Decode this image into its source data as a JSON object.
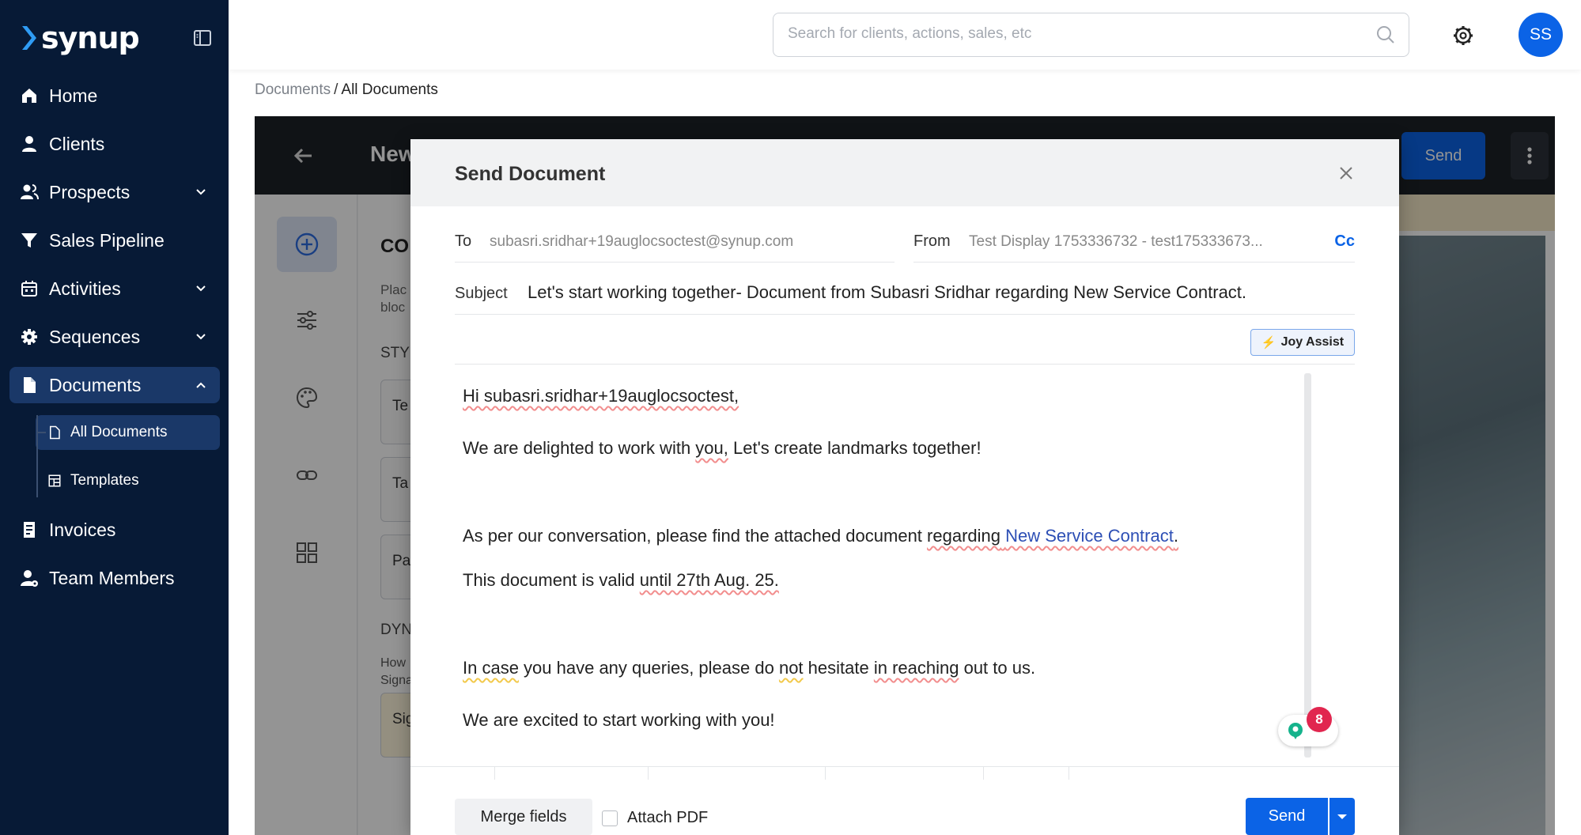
{
  "brand": {
    "name": "synup",
    "accent": "#0b63e6",
    "sidebar_bg": "#071a36"
  },
  "sidebar": {
    "items": [
      {
        "label": "Home",
        "icon": "home-icon"
      },
      {
        "label": "Clients",
        "icon": "user-icon"
      },
      {
        "label": "Prospects",
        "icon": "prospects-icon",
        "expandable": true
      },
      {
        "label": "Sales Pipeline",
        "icon": "funnel-icon"
      },
      {
        "label": "Activities",
        "icon": "calendar-icon",
        "expandable": true
      },
      {
        "label": "Sequences",
        "icon": "gear-icon",
        "expandable": true
      },
      {
        "label": "Documents",
        "icon": "document-icon",
        "expanded": true,
        "active": true
      },
      {
        "label": "Invoices",
        "icon": "invoice-icon"
      },
      {
        "label": "Team Members",
        "icon": "team-icon"
      }
    ],
    "documents_sub": [
      {
        "label": "All Documents",
        "icon": "file-icon",
        "active": true
      },
      {
        "label": "Templates",
        "icon": "template-icon"
      }
    ]
  },
  "topbar": {
    "search_placeholder": "Search for clients, actions, sales, etc",
    "avatar_initials": "SS"
  },
  "breadcrumb": {
    "parent": "Documents",
    "separator": "/",
    "current": "All Documents"
  },
  "editor_bg": {
    "title": "New",
    "send_label": "Send",
    "panel_heading": "CO",
    "panel_text_1": "Plac",
    "panel_text_2": "bloc",
    "styles_label": "STY",
    "boxes": [
      "Te",
      "Ta",
      "Pa"
    ],
    "dynamic_label": "DYN",
    "how_text_1": "How",
    "how_text_2": "Signa",
    "sig_box": "Sig"
  },
  "modal": {
    "title": "Send Document",
    "to_label": "To",
    "to_value": "subasri.sridhar+19auglocsoctest@synup.com",
    "from_label": "From",
    "from_value": "Test Display 1753336732 - test175333673...",
    "cc_label": "Cc",
    "subject_label": "Subject",
    "subject_value": "Let's start working together- Document from Subasri Sridhar regarding New Service Contract.",
    "joy_assist_label": "Joy Assist",
    "body": {
      "greeting": "Hi subasri.sridhar+19auglocsoctest,",
      "line1_a": "We are delighted to work with ",
      "line1_b": "you,",
      "line1_c": " Let's create landmarks together!",
      "line2_a": "As per our conversation, please find the attached document ",
      "line2_b": "regarding",
      "line2_c": " ",
      "line2_link": "New Service Contract",
      "line2_d": ".",
      "line3_a": "This document is valid ",
      "line3_b": "until 27th Aug. 25.",
      "line4_a": "In case",
      "line4_b": " you have any queries, please do ",
      "line4_c": "not",
      "line4_d": " hesitate ",
      "line4_e": "in reaching",
      "line4_f": " out to us.",
      "line5": "We are excited to start working with you!"
    },
    "grammar_badge_count": "8",
    "merge_fields_label": "Merge fields",
    "attach_pdf_label": "Attach PDF",
    "send_label": "Send"
  }
}
